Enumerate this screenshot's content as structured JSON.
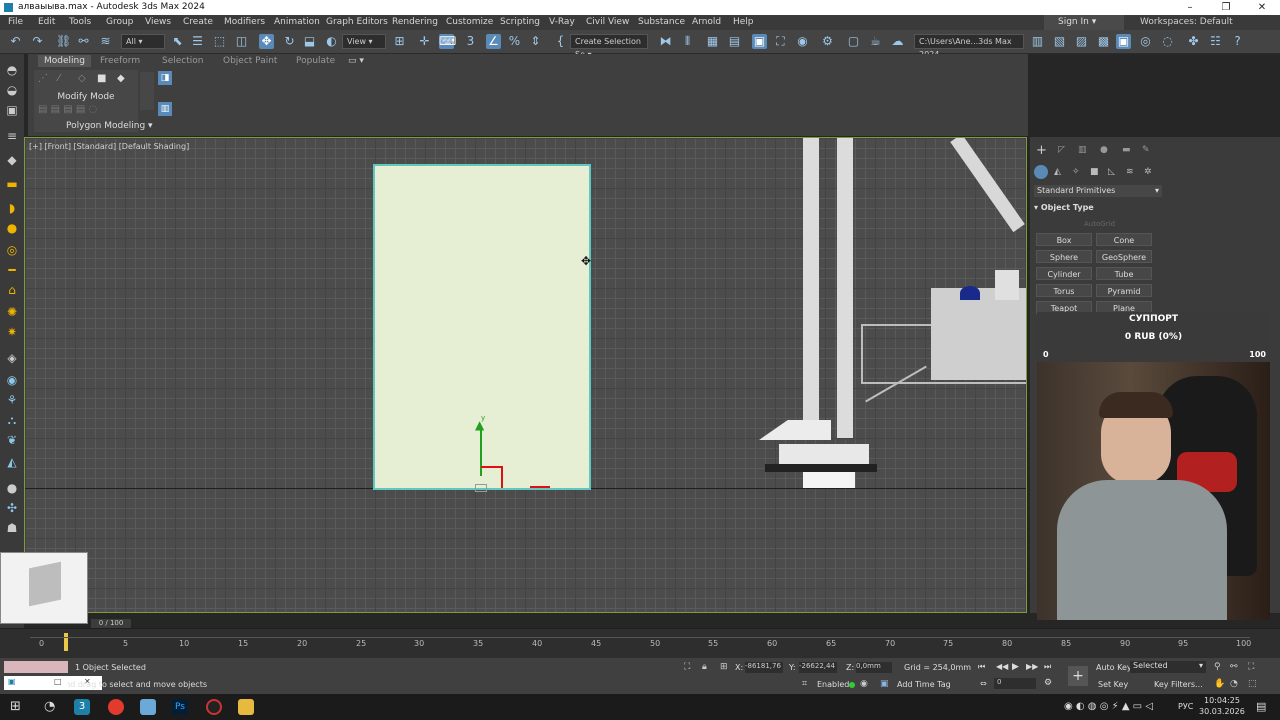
{
  "window": {
    "title": "алваыыва.max - Autodesk 3ds Max 2024",
    "min": "–",
    "max": "❐",
    "close": "✕"
  },
  "menu": [
    "File",
    "Edit",
    "Tools",
    "Group",
    "Views",
    "Create",
    "Modifiers",
    "Animation",
    "Graph Editors",
    "Rendering",
    "Customize",
    "Scripting",
    "V-Ray",
    "Civil View",
    "Substance",
    "Arnold",
    "Help"
  ],
  "sign_in": "Sign In",
  "workspaces_label": "Workspaces:",
  "workspace_value": "Default",
  "toolbar": {
    "selection_filter": "All",
    "ref_coord": "View",
    "selection_set": "Create Selection Se",
    "path": "C:\\Users\\Ane...3ds Max 2024"
  },
  "ribbon": {
    "tabs": [
      "Modeling",
      "Freeform",
      "Selection",
      "Object Paint",
      "Populate"
    ],
    "active_tab": "Modeling",
    "modify_mode": "Modify Mode",
    "polygon_modeling": "Polygon Modeling"
  },
  "viewport": {
    "label": "[+] [Front] [Standard] [Default Shading]"
  },
  "command_panel": {
    "category": "Standard Primitives",
    "rollout": "Object Type",
    "autogrid": "AutoGrid",
    "buttons": [
      "Box",
      "Cone",
      "Sphere",
      "GeoSphere",
      "Cylinder",
      "Tube",
      "Torus",
      "Pyramid",
      "Teapot",
      "Plane"
    ]
  },
  "stream_overlay": {
    "title": "СУППОРТ",
    "amount": "0 RUB (0%)",
    "min": "0",
    "max": "100"
  },
  "timeline": {
    "frame_label": "0 / 100",
    "ticks": [
      "0",
      "5",
      "10",
      "15",
      "20",
      "25",
      "30",
      "35",
      "40",
      "45",
      "50",
      "55",
      "60",
      "65",
      "70",
      "75",
      "80",
      "85",
      "90",
      "95",
      "100"
    ]
  },
  "status": {
    "selected": "1 Object Selected",
    "prompt": "Click and drag to select and move objects",
    "x_label": "X:",
    "x": "-86181,76",
    "y_label": "Y:",
    "y": "-26622,44",
    "z_label": "Z:",
    "z": "0,0mm",
    "grid": "Grid = 254,0mm",
    "enabled": "Enabled:",
    "add_time_tag": "Add Time Tag",
    "auto_key": "Auto Key",
    "set_key": "Set Key",
    "selected_dd": "Selected",
    "key_filters": "Key Filters...",
    "frame": "0"
  },
  "taskbar": {
    "lang": "РУС",
    "time": "10:04:25",
    "date": "30.03.2026"
  },
  "colors": {
    "accent": "#5a8ab8",
    "plane_fill": "#e6eed3",
    "plane_border": "#62c6c0",
    "viewport_border": "#7f9c3d"
  }
}
